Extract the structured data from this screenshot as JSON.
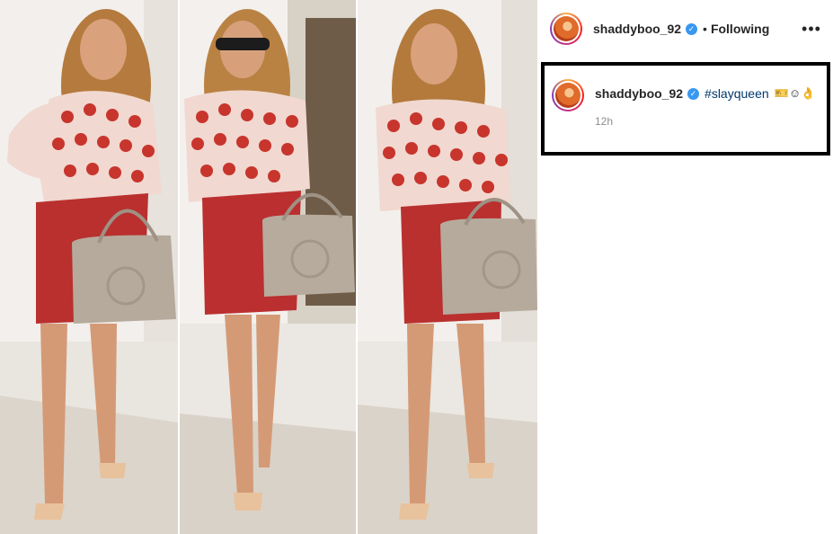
{
  "post": {
    "username": "shaddyboo_92",
    "separator": "•",
    "follow_status": "Following",
    "more_icon": "more-horizontal-icon",
    "verified_icon": "verified-badge-icon",
    "verified_mark": "✓",
    "more_glyph": "•••"
  },
  "comment": {
    "username": "shaddyboo_92",
    "hashtag": "#slayqueen",
    "emojis": "🎫☺👌",
    "timestamp": "12h"
  },
  "colors": {
    "verified": "#3897f0",
    "hashtag": "#00376b",
    "text": "#262626",
    "muted": "#8e8e8e",
    "highlight_border": "#000000"
  }
}
